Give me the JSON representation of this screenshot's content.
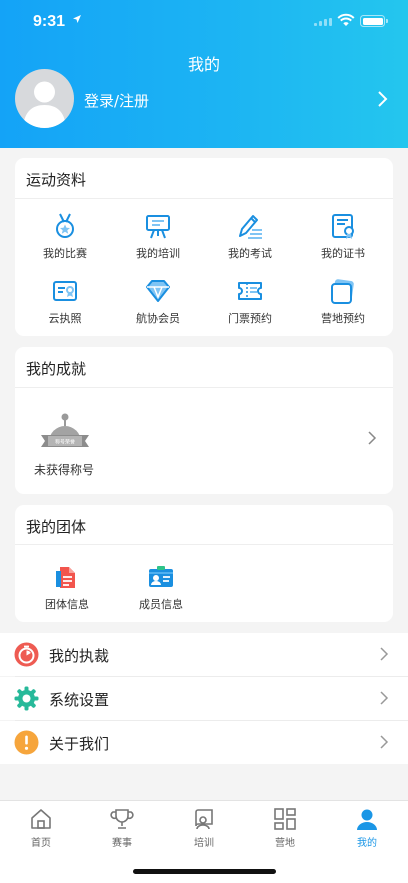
{
  "status": {
    "time": "9:31"
  },
  "header": {
    "title": "我的",
    "login": "登录/注册"
  },
  "sports": {
    "title": "运动资料",
    "items": [
      {
        "label": "我的比赛",
        "icon": "medal-icon"
      },
      {
        "label": "我的培训",
        "icon": "easel-icon"
      },
      {
        "label": "我的考试",
        "icon": "exam-pen-icon"
      },
      {
        "label": "我的证书",
        "icon": "certificate-icon"
      },
      {
        "label": "云执照",
        "icon": "license-icon"
      },
      {
        "label": "航协会员",
        "icon": "diamond-icon"
      },
      {
        "label": "门票预约",
        "icon": "ticket-icon"
      },
      {
        "label": "营地预约",
        "icon": "camp-icon"
      }
    ]
  },
  "achievement": {
    "title": "我的成就",
    "badge_text": "未获得称号"
  },
  "group": {
    "title": "我的团体",
    "items": [
      {
        "label": "团体信息",
        "icon": "group-doc-icon"
      },
      {
        "label": "成员信息",
        "icon": "member-card-icon"
      }
    ]
  },
  "menu": [
    {
      "label": "我的执裁",
      "icon": "timer-icon",
      "color": "#ee5b52"
    },
    {
      "label": "系统设置",
      "icon": "gear-icon",
      "color": "#27b99a"
    },
    {
      "label": "关于我们",
      "icon": "info-icon",
      "color": "#f6a53c"
    }
  ],
  "tabs": [
    {
      "label": "首页",
      "icon": "home-icon"
    },
    {
      "label": "赛事",
      "icon": "trophy-icon"
    },
    {
      "label": "培训",
      "icon": "training-icon"
    },
    {
      "label": "营地",
      "icon": "camp-grid-icon"
    },
    {
      "label": "我的",
      "icon": "user-icon",
      "active": true
    }
  ],
  "colors": {
    "accent": "#1a96e6",
    "header_start": "#14a3f7",
    "header_end": "#24c6ee"
  }
}
